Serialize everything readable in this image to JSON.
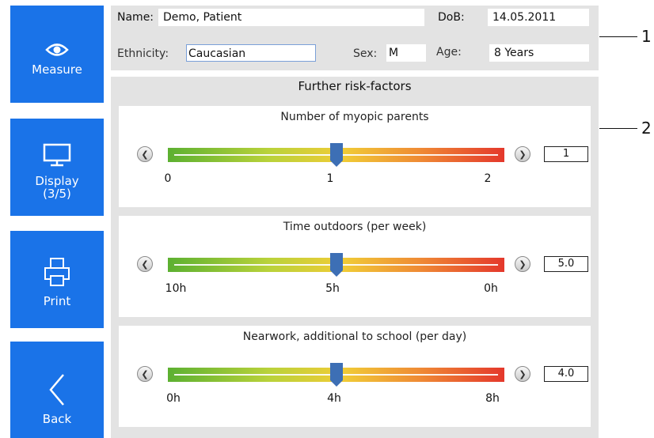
{
  "sidebar": {
    "measure_label": "Measure",
    "display_label": "Display\n(3/5)",
    "print_label": "Print",
    "back_label": "Back"
  },
  "patient": {
    "name_label": "Name:",
    "name_value": "Demo, Patient",
    "dob_label": "DoB:",
    "dob_value": "14.05.2011",
    "ethnicity_label": "Ethnicity:",
    "ethnicity_value": "Caucasian",
    "sex_label": "Sex:",
    "sex_value": "M",
    "age_label": "Age:",
    "age_value": "8 Years"
  },
  "risk": {
    "title": "Further risk-factors",
    "sliders": [
      {
        "title": "Number of myopic parents",
        "ticks": [
          "0",
          "1",
          "2"
        ],
        "value": "1",
        "position": 0.5
      },
      {
        "title": "Time outdoors (per week)",
        "ticks": [
          "10h",
          "5h",
          "0h"
        ],
        "value": "5.0",
        "position": 0.5
      },
      {
        "title": "Nearwork, additional to school (per day)",
        "ticks": [
          "0h",
          "4h",
          "8h"
        ],
        "value": "4.0",
        "position": 0.5
      }
    ]
  },
  "callouts": [
    "1",
    "2"
  ],
  "colors": {
    "accent": "#1a73e8",
    "marker": "#3d6fb5",
    "panel": "#e3e3e3"
  }
}
